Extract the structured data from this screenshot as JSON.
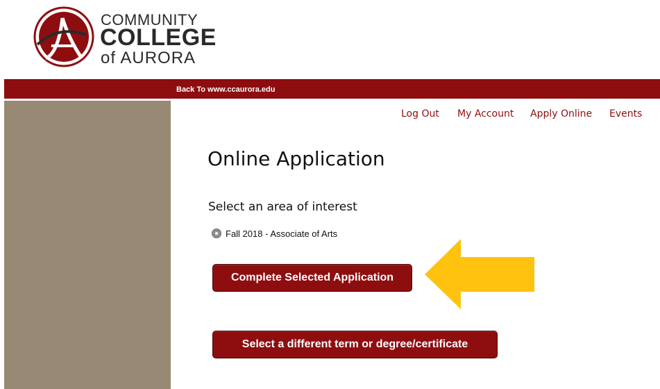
{
  "logo": {
    "line1": "COMMUNITY",
    "line2": "COLLEGE",
    "line3": "of AURORA",
    "brand_color": "#8e0e10"
  },
  "topbar": {
    "back_link": "Back To www.ccaurora.edu",
    "color": "#8e0e10"
  },
  "sidebar": {
    "color": "#978974"
  },
  "nav": {
    "items": [
      {
        "label": "Log Out"
      },
      {
        "label": "My Account"
      },
      {
        "label": "Apply Online"
      },
      {
        "label": "Events"
      }
    ]
  },
  "main": {
    "title": "Online Application",
    "subhead": "Select an area of interest",
    "options": [
      {
        "label": "Fall 2018 - Associate of Arts",
        "selected": true
      }
    ],
    "complete_button": "Complete Selected Application",
    "different_button": "Select a different term or degree/certificate"
  },
  "annotation": {
    "arrow_color": "#ffc20e",
    "arrow_direction": "left",
    "icon": "arrow-left-icon"
  }
}
